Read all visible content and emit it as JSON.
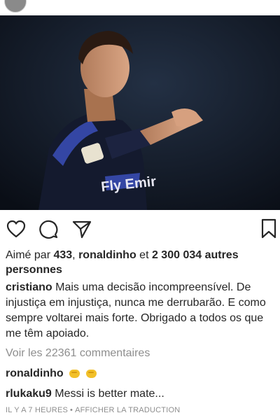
{
  "post": {
    "image_alt": "Footballer in dark blue kit pointing",
    "jersey_text": "Fly Emir"
  },
  "actions": {
    "like_icon": "heart-icon",
    "comment_icon": "comment-icon",
    "share_icon": "share-icon",
    "save_icon": "bookmark-icon"
  },
  "likes": {
    "prefix": "Aimé par ",
    "count_user": "433",
    "sep": ", ",
    "user": "ronaldinho",
    "and": " et ",
    "others": "2 300 034 autres personnes"
  },
  "caption": {
    "username": "cristiano",
    "text": "Mais uma decisão incompreensível. De injustiça em injustiça, nunca me derrubarão. E como sempre voltarei mais forte. Obrigado a todos os que me têm apoiado."
  },
  "view_comments": "Voir les 22361 commentaires",
  "comments": [
    {
      "username": "ronaldinho",
      "text": ""
    },
    {
      "username": "rlukaku9",
      "text": "Messi is better mate..."
    }
  ],
  "meta": {
    "time": "IL Y A 7 HEURES",
    "separator": "•",
    "translate": "AFFICHER LA TRADUCTION"
  }
}
